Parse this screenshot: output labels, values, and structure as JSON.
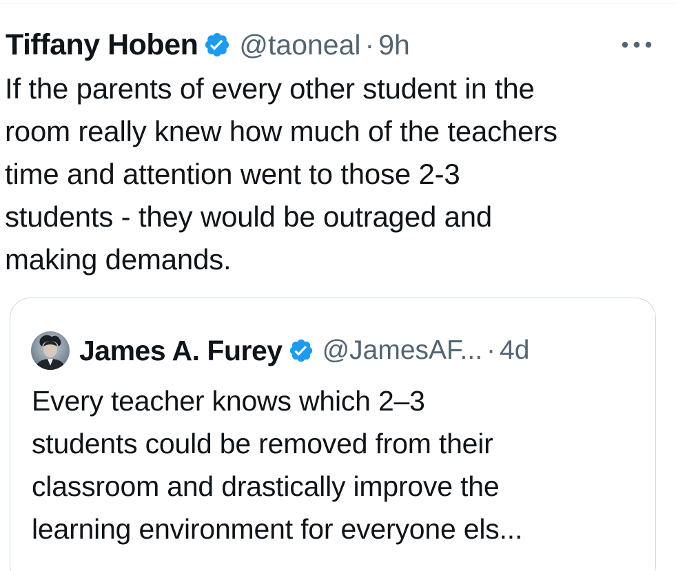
{
  "tweet": {
    "author_name": "Tiffany Hoben",
    "handle": "@taoneal",
    "separator": "·",
    "time": "9h",
    "more_icon": "more-horizontal-icon",
    "verified_icon": "verified-badge-icon",
    "text": "If the parents of every other student in the\nroom really knew how much of the teachers\ntime and attention went to those 2-3\nstudents - they would be outraged and\nmaking demands."
  },
  "quoted_tweet": {
    "author_name": "James A. Furey",
    "handle": "@JamesAF...",
    "separator": "·",
    "time": "4d",
    "avatar_icon": "avatar",
    "verified_icon": "verified-badge-icon",
    "text": "Every teacher knows which 2–3\nstudents could be removed from their\nclassroom and drastically improve the\nlearning  environment for everyone els..."
  },
  "colors": {
    "verified": "#1d9bf0",
    "text_primary": "#0f1419",
    "text_secondary": "#536471",
    "border": "#cfd9de"
  }
}
